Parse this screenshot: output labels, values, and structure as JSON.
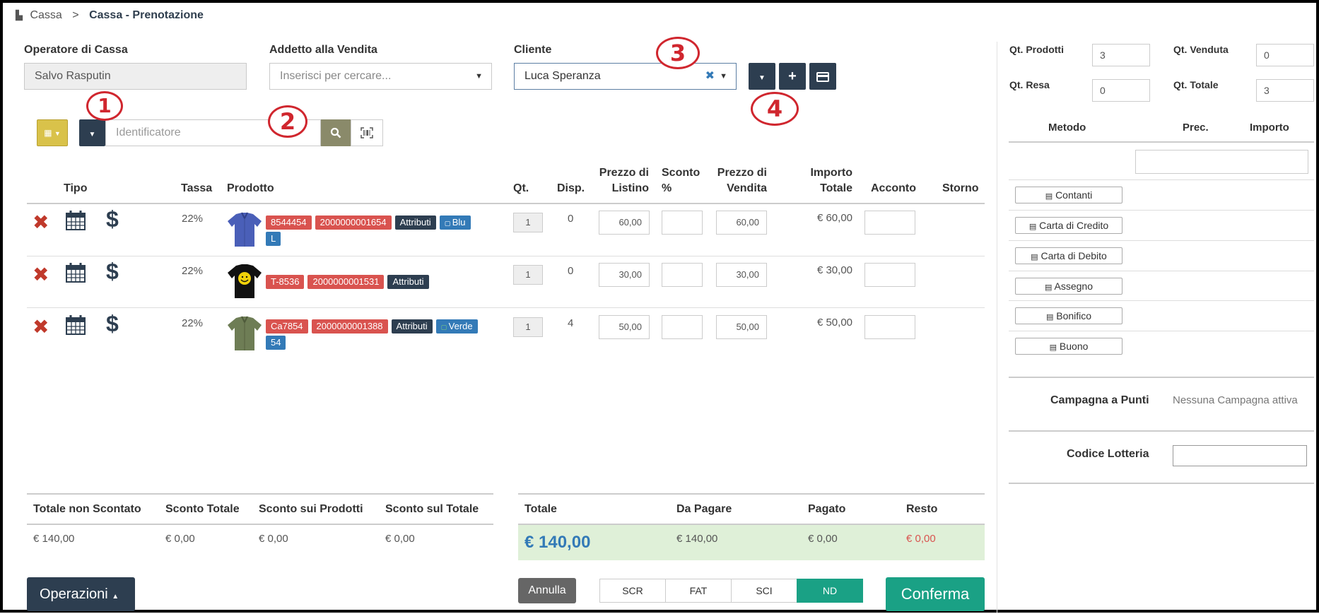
{
  "breadcrumb": {
    "home": "Cassa",
    "separator": ">",
    "current": "Cassa - Prenotazione"
  },
  "header": {
    "operator_label": "Operatore di Cassa",
    "operator_value": "Salvo Rasputin",
    "seller_label": "Addetto alla Vendita",
    "seller_placeholder": "Inserisci per cercare...",
    "client_label": "Cliente",
    "client_value": "Luca Speranza"
  },
  "search": {
    "placeholder": "Identificatore"
  },
  "annotations": [
    "1",
    "2",
    "3",
    "4"
  ],
  "table": {
    "headers": {
      "tipo": "Tipo",
      "tassa": "Tassa",
      "prodotto": "Prodotto",
      "qt": "Qt.",
      "disp": "Disp.",
      "listino_1": "Prezzo di",
      "listino_2": "Listino",
      "sconto_1": "Sconto",
      "sconto_2": "%",
      "vendita_1": "Prezzo di",
      "vendita_2": "Vendita",
      "totale_1": "Importo",
      "totale_2": "Totale",
      "acconto": "Acconto",
      "storno": "Storno"
    },
    "rows": [
      {
        "tassa": "22%",
        "code": "8544454",
        "barcode": "2000000001654",
        "attr": "Attributi",
        "color": "Blu",
        "size": "L",
        "qt": "1",
        "disp": "0",
        "listino": "60,00",
        "vendita": "60,00",
        "totale": "€ 60,00"
      },
      {
        "tassa": "22%",
        "code": "T-8536",
        "barcode": "2000000001531",
        "attr": "Attributi",
        "qt": "1",
        "disp": "0",
        "listino": "30,00",
        "vendita": "30,00",
        "totale": "€ 30,00"
      },
      {
        "tassa": "22%",
        "code": "Ca7854",
        "barcode": "2000000001388",
        "attr": "Attributi",
        "color": "Verde",
        "size": "54",
        "qt": "1",
        "disp": "4",
        "listino": "50,00",
        "vendita": "50,00",
        "totale": "€ 50,00"
      }
    ]
  },
  "totals": {
    "non_scontato_label": "Totale non Scontato",
    "non_scontato": "€ 140,00",
    "sconto_totale_label": "Sconto Totale",
    "sconto_totale": "€ 0,00",
    "sconto_prodotti_label": "Sconto sui Prodotti",
    "sconto_prodotti": "€ 0,00",
    "sconto_sul_totale_label": "Sconto sul Totale",
    "sconto_sul_totale": "€ 0,00",
    "totale_label": "Totale",
    "totale": "€ 140,00",
    "da_pagare_label": "Da Pagare",
    "da_pagare": "€ 140,00",
    "pagato_label": "Pagato",
    "pagato": "€ 0,00",
    "resto_label": "Resto",
    "resto": "€ 0,00"
  },
  "footer": {
    "operazioni": "Operazioni",
    "annulla": "Annulla",
    "doc_types": [
      "SCR",
      "FAT",
      "SCI",
      "ND"
    ],
    "doc_selected": "ND",
    "conferma": "Conferma"
  },
  "sidebar": {
    "qt_prodotti_label": "Qt. Prodotti",
    "qt_prodotti": "3",
    "qt_venduta_label": "Qt. Venduta",
    "qt_venduta": "0",
    "qt_resa_label": "Qt. Resa",
    "qt_resa": "0",
    "qt_totale_label": "Qt. Totale",
    "qt_totale": "3",
    "metodo_label": "Metodo",
    "prec_label": "Prec.",
    "importo_label": "Importo",
    "methods": [
      "Contanti",
      "Carta di Credito",
      "Carta di Debito",
      "Assegno",
      "Bonifico",
      "Buono"
    ],
    "campagna_label": "Campagna a Punti",
    "campagna_value": "Nessuna Campagna attiva",
    "lotteria_label": "Codice Lotteria"
  },
  "colors": {
    "dark": "#2d3e50",
    "badge_red": "#d9534f",
    "badge_blue": "#337ab7",
    "success": "#1aa185",
    "total_bg": "#dff0d8",
    "total_text": "#337ab7",
    "resto": "#d9534f",
    "annotation": "#d0262e",
    "calendar_btn": "#d9c24a",
    "search_btn": "#8a8a6a"
  },
  "icons": {
    "remove": "x-icon",
    "calendar": "calendar-icon",
    "dollar": "dollar-icon",
    "search": "search-icon",
    "barcode": "barcode-scan-icon",
    "plus": "plus-icon",
    "card": "credit-card-icon"
  }
}
